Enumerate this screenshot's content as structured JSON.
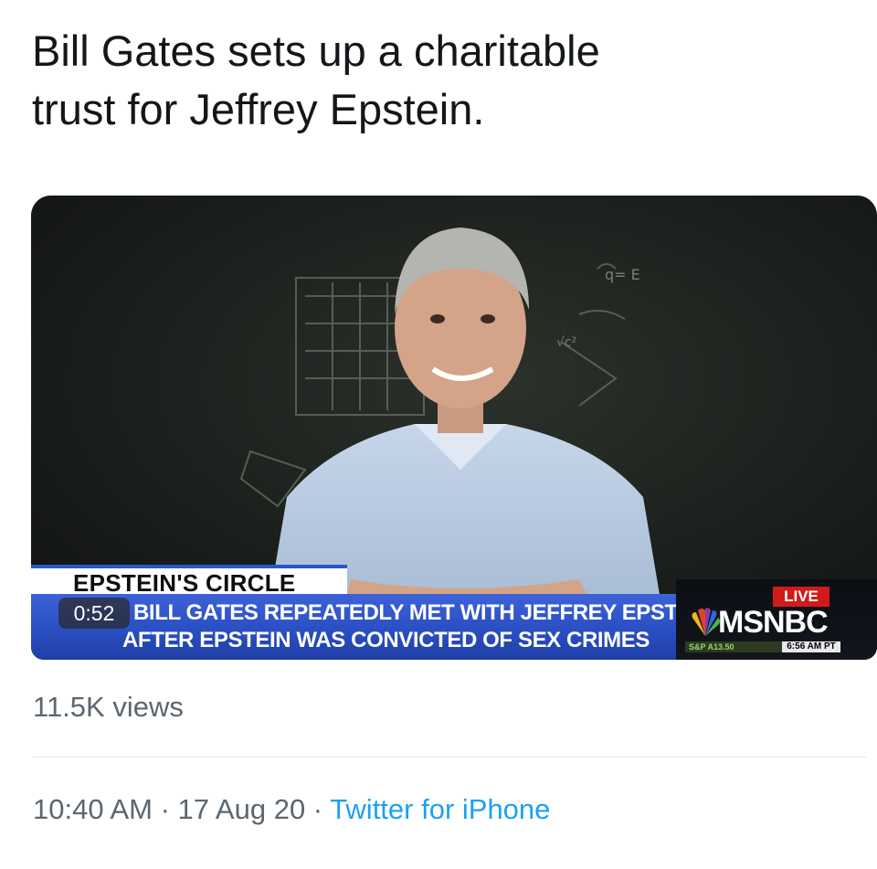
{
  "tweet": {
    "text_line1": "Bill Gates sets up a charitable",
    "text_line2": "trust for Jeffrey Epstein."
  },
  "video": {
    "duration": "0:52",
    "lower_third_title": "EPSTEIN'S CIRCLE",
    "headline_line1": "BILL GATES REPEATEDLY MET WITH JEFFREY EPSTEIN",
    "headline_line2": "AFTER EPSTEIN WAS CONVICTED OF SEX CRIMES",
    "live_label": "LIVE",
    "network": "MSNBC",
    "ticker": "S&P  A13.50",
    "clock": "6:56 AM PT"
  },
  "stats": {
    "views": "11.5K views"
  },
  "meta": {
    "time": "10:40 AM",
    "separator": " · ",
    "date": "17 Aug 20",
    "source": "Twitter for iPhone"
  },
  "colors": {
    "link": "#1da1f2",
    "muted": "#5b6670",
    "msnbc_blue": "#2a4fc2",
    "live_red": "#d21a1a"
  }
}
